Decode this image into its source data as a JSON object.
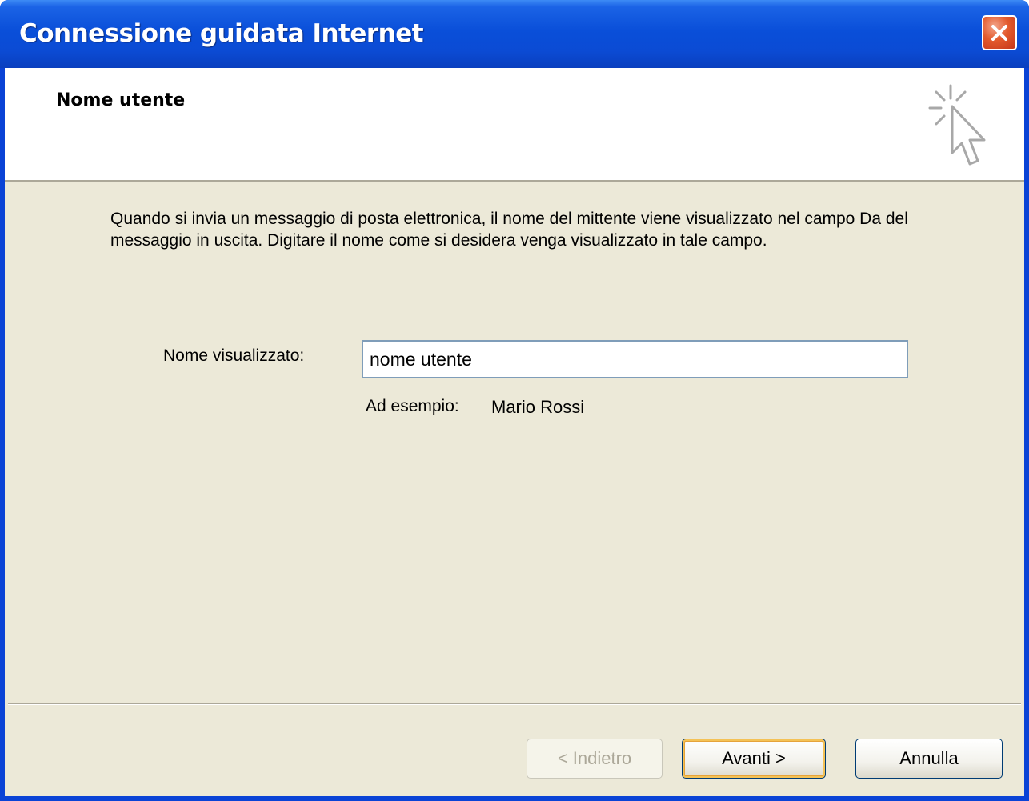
{
  "window": {
    "title": "Connessione guidata Internet",
    "close_icon": "close-icon"
  },
  "header": {
    "title": "Nome utente",
    "icon": "wizard-cursor-icon"
  },
  "body": {
    "description": "Quando si invia un messaggio di posta elettronica, il nome del mittente viene visualizzato nel campo Da del messaggio in uscita. Digitare il nome come si desidera venga visualizzato in tale campo.",
    "field_label": "Nome visualizzato:",
    "field_value": "nome utente",
    "example_label": "Ad esempio:",
    "example_value": "Mario Rossi"
  },
  "buttons": {
    "back": "< Indietro",
    "next": "Avanti >",
    "cancel": "Annulla"
  },
  "colors": {
    "titlebar": "#0a4fd9",
    "dialog_background": "#ece9d8",
    "close_button": "#e35a2c",
    "default_button_highlight": "#f4c256"
  }
}
